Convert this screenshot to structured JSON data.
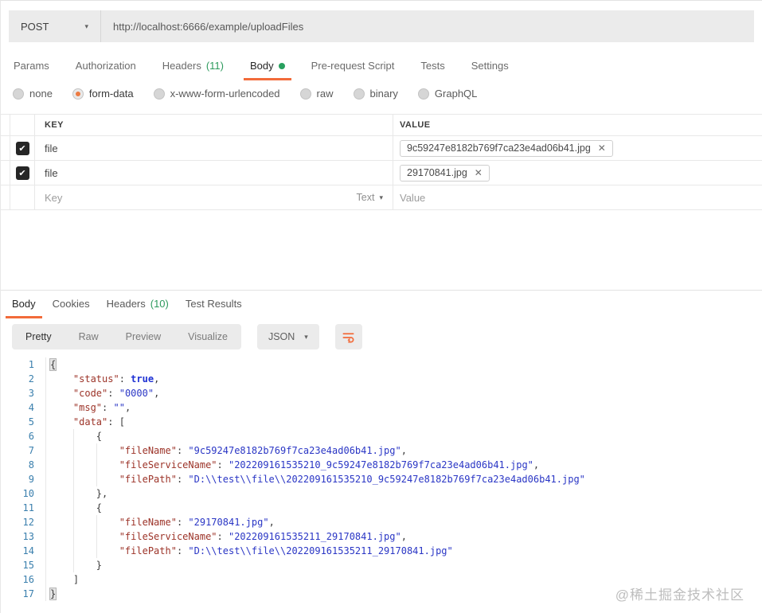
{
  "icons": {
    "caret_down": "▾",
    "check": "✔",
    "close": "✕"
  },
  "request": {
    "method": "POST",
    "url": "http://localhost:6666/example/uploadFiles",
    "tabs": [
      {
        "label": "Params",
        "active": false
      },
      {
        "label": "Authorization",
        "active": false
      },
      {
        "label": "Headers",
        "badge": "(11)",
        "active": false
      },
      {
        "label": "Body",
        "dot": true,
        "active": true
      },
      {
        "label": "Pre-request Script",
        "active": false
      },
      {
        "label": "Tests",
        "active": false
      },
      {
        "label": "Settings",
        "active": false
      }
    ],
    "body_modes": [
      {
        "label": "none",
        "selected": false
      },
      {
        "label": "form-data",
        "selected": true
      },
      {
        "label": "x-www-form-urlencoded",
        "selected": false
      },
      {
        "label": "raw",
        "selected": false
      },
      {
        "label": "binary",
        "selected": false
      },
      {
        "label": "GraphQL",
        "selected": false
      }
    ],
    "form_table": {
      "key_header": "KEY",
      "value_header": "VALUE",
      "rows": [
        {
          "checked": true,
          "key": "file",
          "value_chip": "9c59247e8182b769f7ca23e4ad06b41.jpg"
        },
        {
          "checked": true,
          "key": "file",
          "value_chip": "29170841.jpg"
        }
      ],
      "placeholder_row": {
        "key_placeholder": "Key",
        "type_label": "Text",
        "value_placeholder": "Value"
      }
    }
  },
  "response": {
    "tabs": [
      {
        "label": "Body",
        "active": true
      },
      {
        "label": "Cookies",
        "active": false
      },
      {
        "label": "Headers",
        "badge": "(10)",
        "active": false
      },
      {
        "label": "Test Results",
        "active": false
      }
    ],
    "toolbar": {
      "views": [
        {
          "label": "Pretty",
          "active": true
        },
        {
          "label": "Raw",
          "active": false
        },
        {
          "label": "Preview",
          "active": false
        },
        {
          "label": "Visualize",
          "active": false
        }
      ],
      "format": "JSON"
    },
    "code_lines": [
      {
        "n": 1,
        "tokens": [
          [
            "hl",
            "{"
          ]
        ]
      },
      {
        "n": 2,
        "tokens": [
          [
            "sp",
            "    "
          ],
          [
            "k",
            "\"status\""
          ],
          [
            "p",
            ": "
          ],
          [
            "b",
            "true"
          ],
          [
            "p",
            ","
          ]
        ]
      },
      {
        "n": 3,
        "tokens": [
          [
            "sp",
            "    "
          ],
          [
            "k",
            "\"code\""
          ],
          [
            "p",
            ": "
          ],
          [
            "s",
            "\"0000\""
          ],
          [
            "p",
            ","
          ]
        ]
      },
      {
        "n": 4,
        "tokens": [
          [
            "sp",
            "    "
          ],
          [
            "k",
            "\"msg\""
          ],
          [
            "p",
            ": "
          ],
          [
            "s",
            "\"\""
          ],
          [
            "p",
            ","
          ]
        ]
      },
      {
        "n": 5,
        "tokens": [
          [
            "sp",
            "    "
          ],
          [
            "k",
            "\"data\""
          ],
          [
            "p",
            ": "
          ],
          [
            "p",
            "["
          ]
        ]
      },
      {
        "n": 6,
        "tokens": [
          [
            "sp",
            "        "
          ],
          [
            "p",
            "{"
          ]
        ]
      },
      {
        "n": 7,
        "tokens": [
          [
            "sp",
            "            "
          ],
          [
            "k",
            "\"fileName\""
          ],
          [
            "p",
            ": "
          ],
          [
            "s",
            "\"9c59247e8182b769f7ca23e4ad06b41.jpg\""
          ],
          [
            "p",
            ","
          ]
        ]
      },
      {
        "n": 8,
        "tokens": [
          [
            "sp",
            "            "
          ],
          [
            "k",
            "\"fileServiceName\""
          ],
          [
            "p",
            ": "
          ],
          [
            "s",
            "\"202209161535210_9c59247e8182b769f7ca23e4ad06b41.jpg\""
          ],
          [
            "p",
            ","
          ]
        ]
      },
      {
        "n": 9,
        "tokens": [
          [
            "sp",
            "            "
          ],
          [
            "k",
            "\"filePath\""
          ],
          [
            "p",
            ": "
          ],
          [
            "s",
            "\"D:\\\\test\\\\file\\\\202209161535210_9c59247e8182b769f7ca23e4ad06b41.jpg\""
          ]
        ]
      },
      {
        "n": 10,
        "tokens": [
          [
            "sp",
            "        "
          ],
          [
            "p",
            "},"
          ]
        ]
      },
      {
        "n": 11,
        "tokens": [
          [
            "sp",
            "        "
          ],
          [
            "p",
            "{"
          ]
        ]
      },
      {
        "n": 12,
        "tokens": [
          [
            "sp",
            "            "
          ],
          [
            "k",
            "\"fileName\""
          ],
          [
            "p",
            ": "
          ],
          [
            "s",
            "\"29170841.jpg\""
          ],
          [
            "p",
            ","
          ]
        ]
      },
      {
        "n": 13,
        "tokens": [
          [
            "sp",
            "            "
          ],
          [
            "k",
            "\"fileServiceName\""
          ],
          [
            "p",
            ": "
          ],
          [
            "s",
            "\"202209161535211_29170841.jpg\""
          ],
          [
            "p",
            ","
          ]
        ]
      },
      {
        "n": 14,
        "tokens": [
          [
            "sp",
            "            "
          ],
          [
            "k",
            "\"filePath\""
          ],
          [
            "p",
            ": "
          ],
          [
            "s",
            "\"D:\\\\test\\\\file\\\\202209161535211_29170841.jpg\""
          ]
        ]
      },
      {
        "n": 15,
        "tokens": [
          [
            "sp",
            "        "
          ],
          [
            "p",
            "}"
          ]
        ]
      },
      {
        "n": 16,
        "tokens": [
          [
            "sp",
            "    "
          ],
          [
            "p",
            "]"
          ]
        ]
      },
      {
        "n": 17,
        "tokens": [
          [
            "hl",
            "}"
          ]
        ]
      }
    ]
  },
  "watermark": "@稀土掘金技术社区",
  "colors": {
    "accent_orange": "#f26b3a",
    "success_green": "#2d9a5d",
    "json_key": "#9c3328",
    "json_string": "#2a36c5",
    "line_number": "#3a7fad",
    "toolbar_gray": "#ebebeb"
  }
}
